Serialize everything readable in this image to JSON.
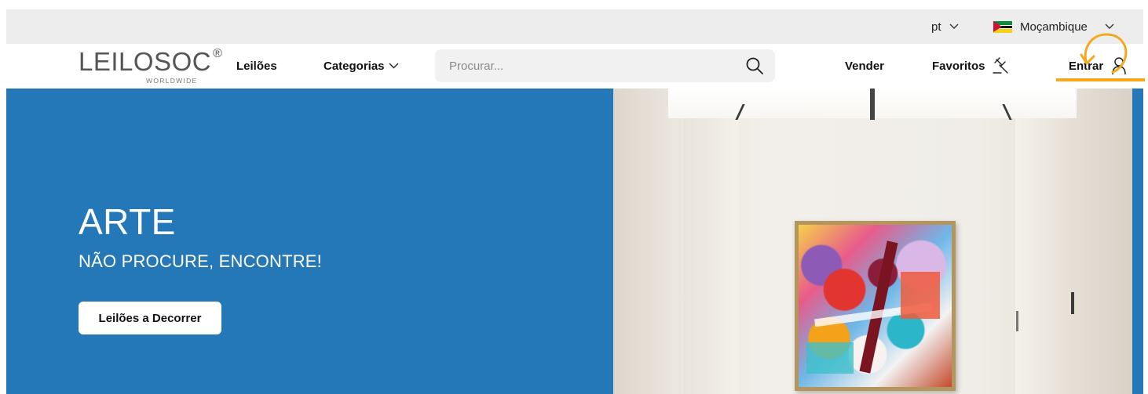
{
  "topbar": {
    "language": "pt",
    "country": "Moçambique"
  },
  "brand": {
    "name": "LEILOSOC",
    "reg_mark": "®",
    "tagline": "WORLDWIDE"
  },
  "nav": {
    "auctions": "Leilões",
    "categories": "Categorias",
    "sell": "Vender",
    "favorites": "Favoritos",
    "login": "Entrar"
  },
  "search": {
    "placeholder": "Procurar..."
  },
  "hero": {
    "title": "ARTE",
    "subtitle": "NÃO PROCURE, ENCONTRE!",
    "cta": "Leilões a Decorrer"
  },
  "colors": {
    "hero_blue": "#2578b8",
    "highlight_orange": "#f5a81c"
  },
  "icons": {
    "search": "search-icon",
    "favorites": "gavel-icon",
    "login": "user-icon",
    "dropdown": "chevron-down-icon"
  }
}
